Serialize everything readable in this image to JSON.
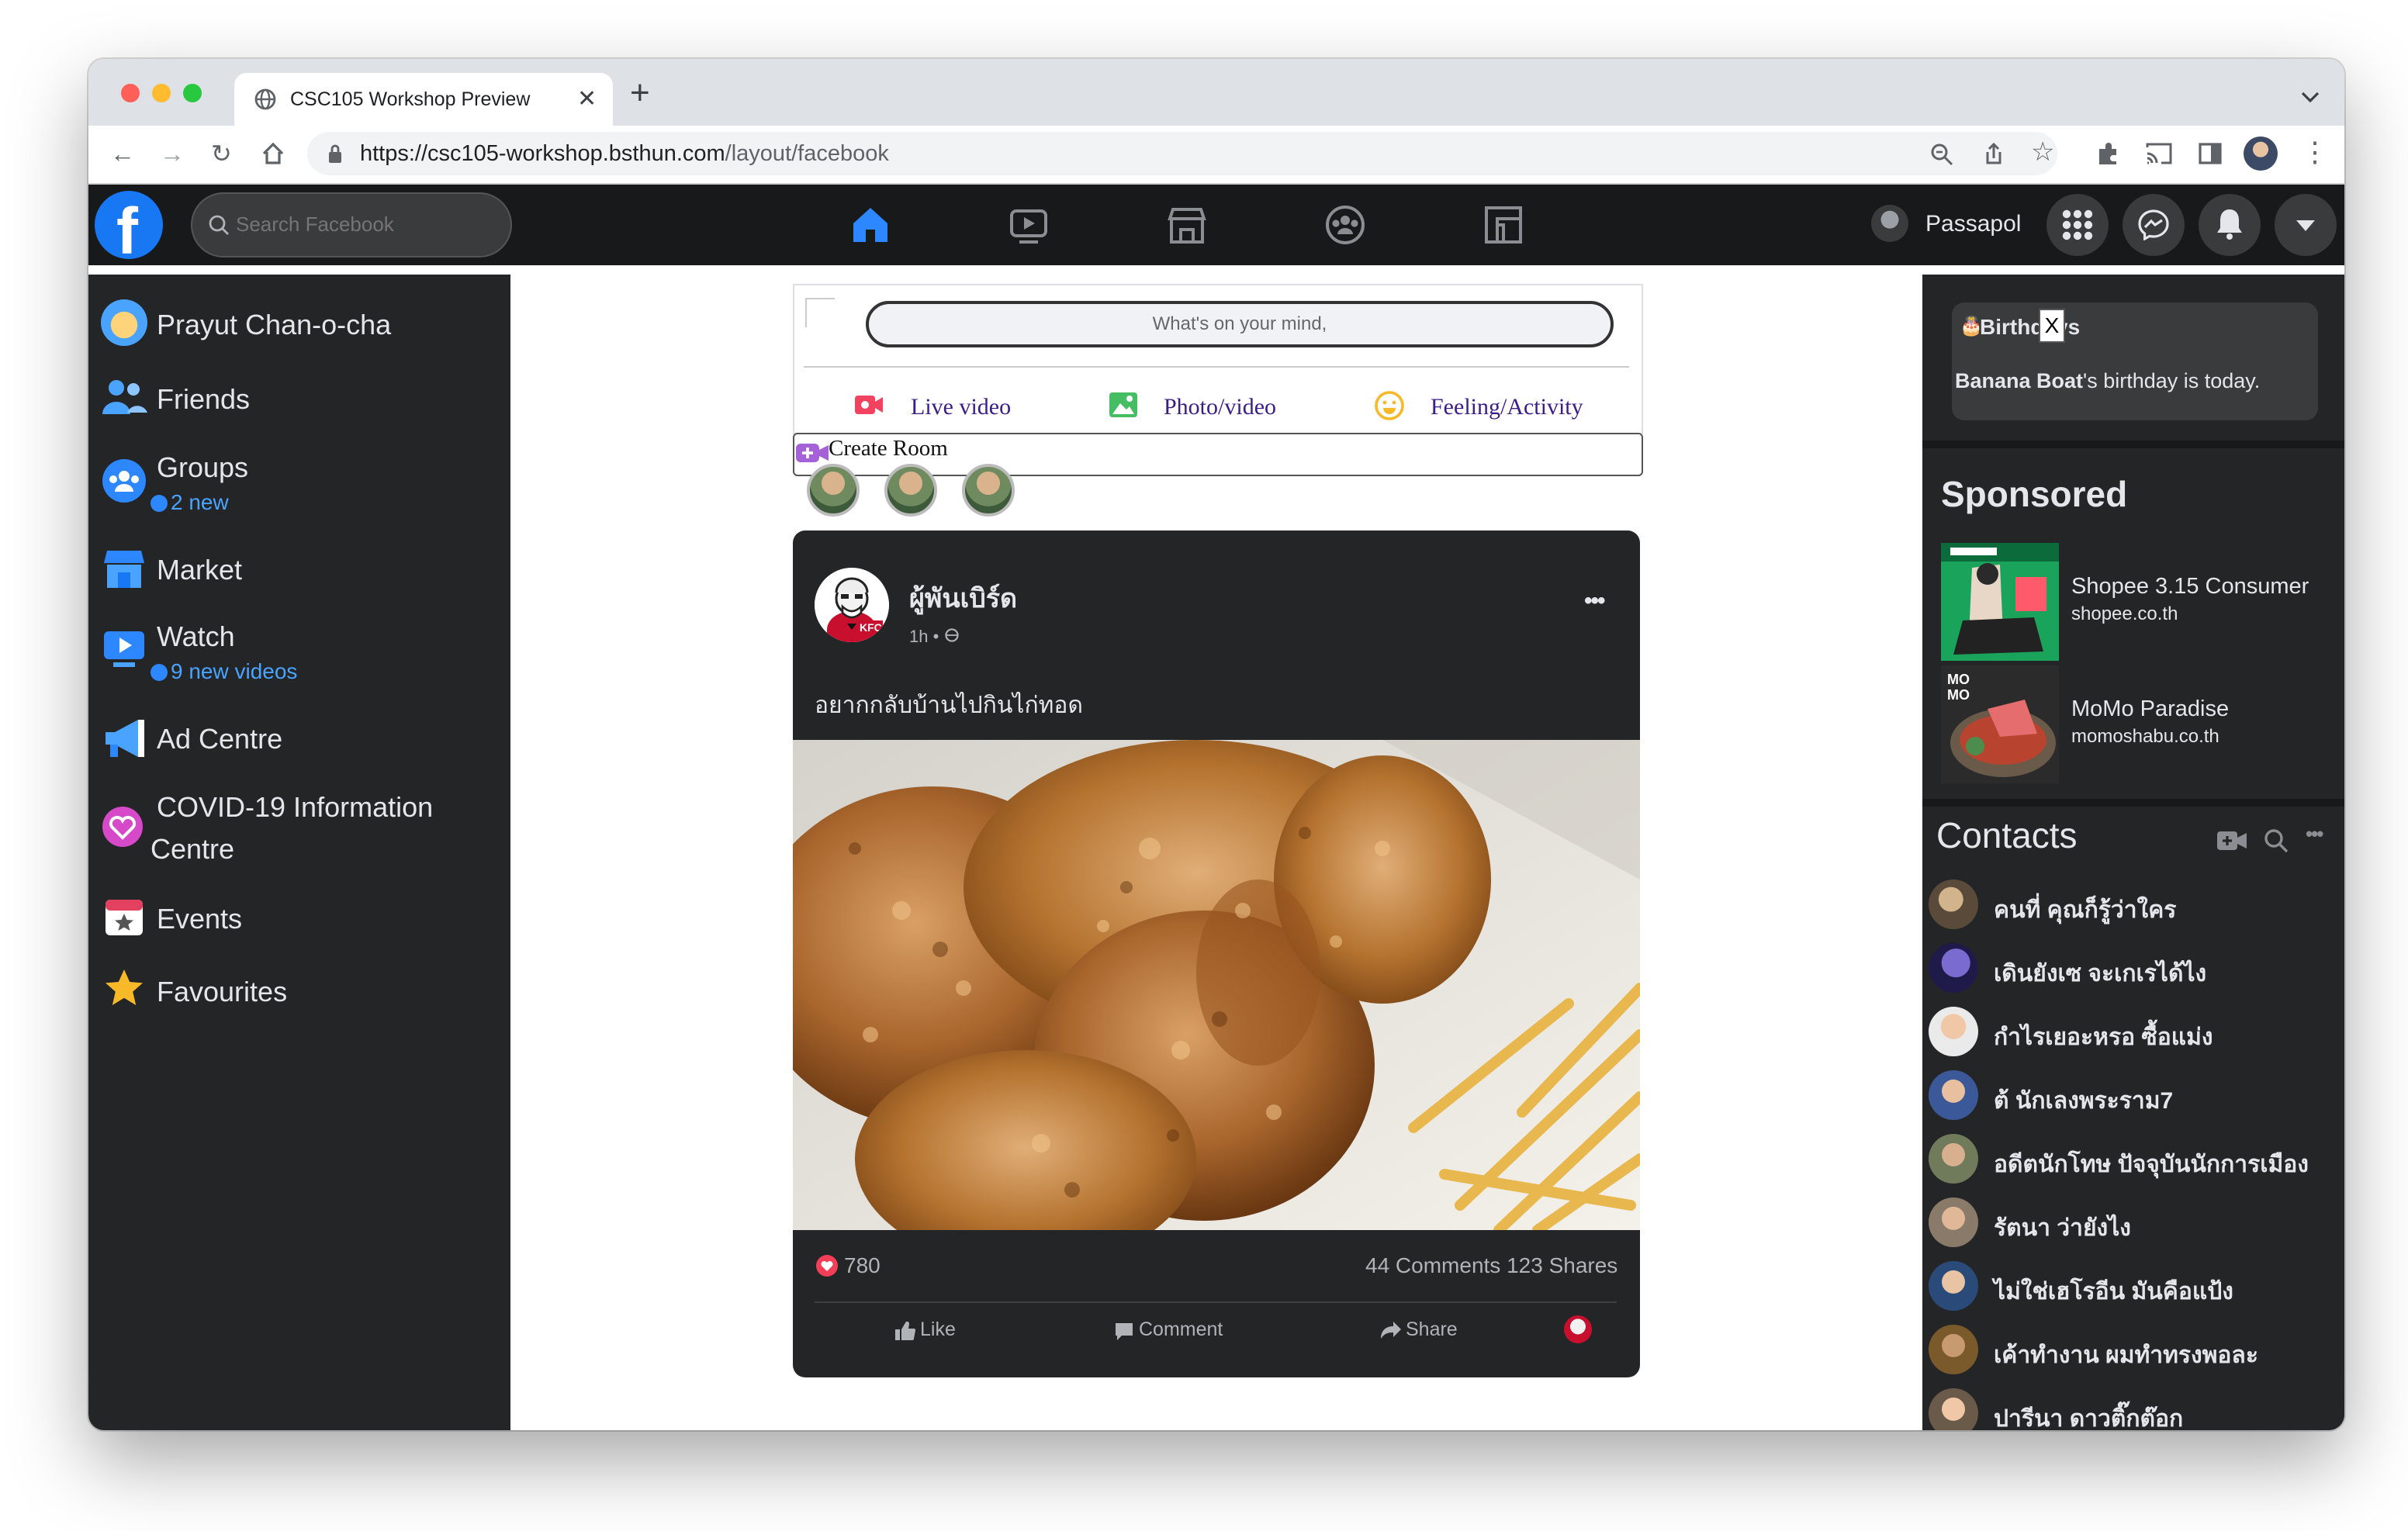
{
  "browser": {
    "tab_title": "CSC105 Workshop Preview",
    "url_host": "https://csc105-workshop.bsthun.com",
    "url_path": "/layout/facebook"
  },
  "nav": {
    "search_placeholder": "Search Facebook",
    "user_name": "Passapol"
  },
  "sidebar": {
    "items": [
      {
        "label": "Prayut Chan-o-cha"
      },
      {
        "label": "Friends"
      },
      {
        "label": "Groups",
        "sub": "2 new"
      },
      {
        "label": "Market"
      },
      {
        "label": "Watch",
        "sub": "9 new videos"
      },
      {
        "label": "Ad Centre"
      },
      {
        "label": "COVID-19 Information",
        "label2": "Centre"
      },
      {
        "label": "Events"
      },
      {
        "label": "Favourites"
      }
    ]
  },
  "composer": {
    "placeholder": "What's on your mind,",
    "actions": [
      "Live video",
      "Photo/video",
      "Feeling/Activity"
    ],
    "create_room": "Create Room"
  },
  "post": {
    "author": "ผู้พันเบิร์ด",
    "time": "1h •",
    "text": "อยากกลับบ้านไปกินไก่ทอด",
    "reactions": "780",
    "comments_shares": "44 Comments 123 Shares",
    "actions": [
      "Like",
      "Comment",
      "Share"
    ],
    "more": "•••"
  },
  "birthdays": {
    "title": "Birthdays",
    "close": "X",
    "name": "Banana Boat",
    "text": "'s birthday is today."
  },
  "sponsored": {
    "title": "Sponsored",
    "items": [
      {
        "title": "Shopee 3.15 Consumer",
        "domain": "shopee.co.th"
      },
      {
        "title": "MoMo Paradise",
        "domain": "momoshabu.co.th"
      }
    ]
  },
  "contacts": {
    "title": "Contacts",
    "items": [
      "คนที่ คุณก็รู้ว่าใคร",
      "เดินยังเซ จะเกเรได้ไง",
      "กำไรเยอะหรอ ซื้อแม่ง",
      "ต้ นักเลงพระราม7",
      "อดีตนักโทษ ปัจจุบันนักการเมือง",
      "รัตนา ว่ายังไง",
      "ไม่ใช่เฮโรอีน มันคือแป้ง",
      "เค้าทำงาน ผมทำทรงพอละ",
      "ปารีนา ดาวติ๊กต๊อก"
    ]
  }
}
